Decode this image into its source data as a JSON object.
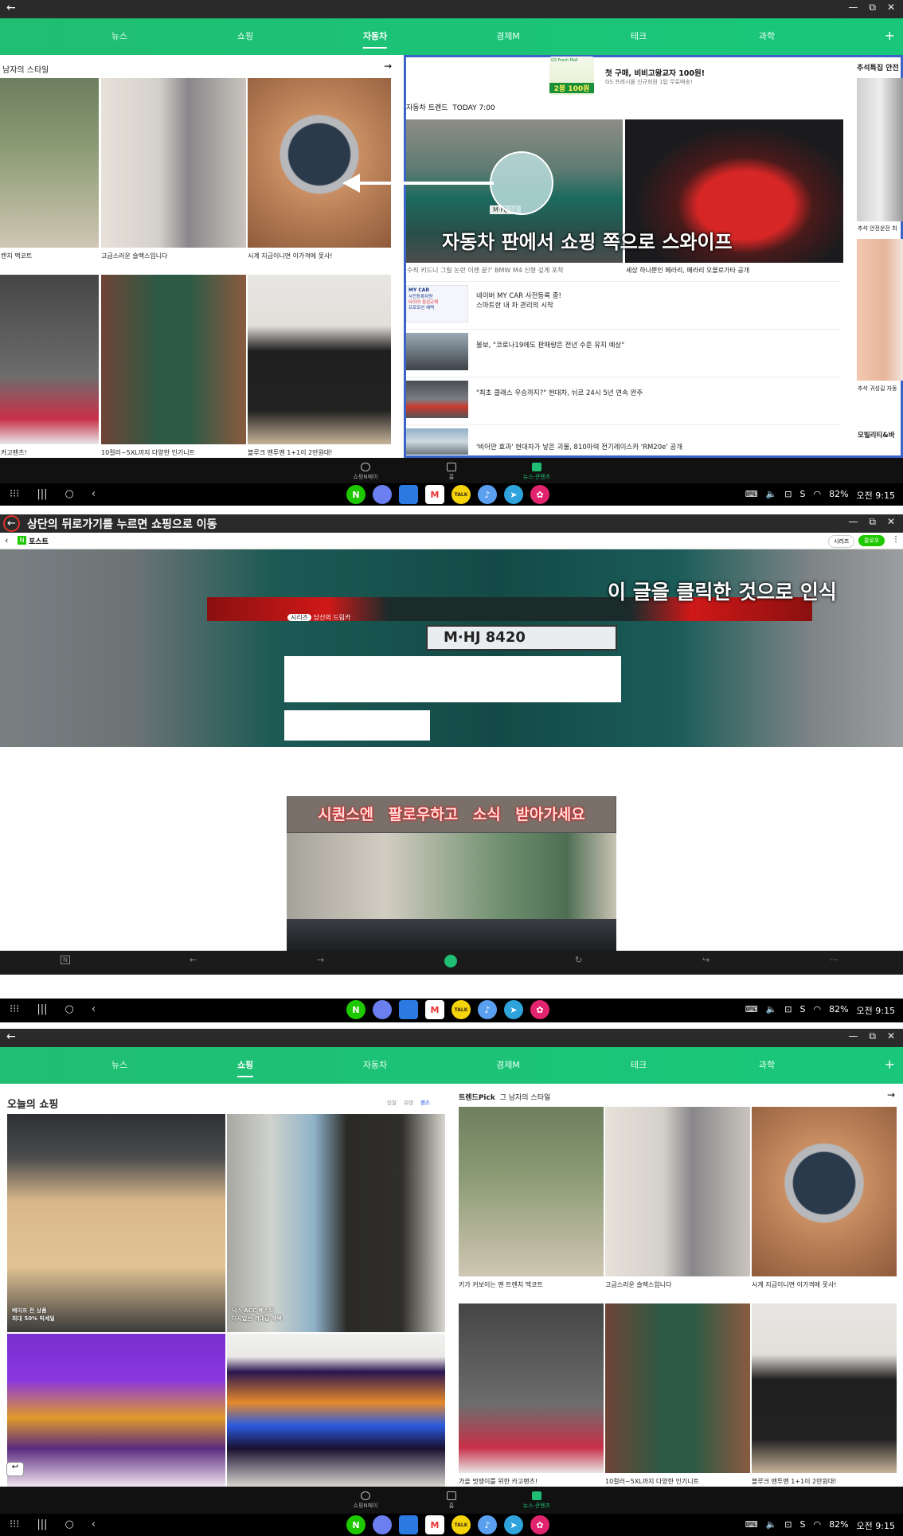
{
  "panel1": {
    "tabs": [
      "뉴스",
      "쇼핑",
      "자동차",
      "경제M",
      "테크",
      "과학"
    ],
    "active_tab": "자동차",
    "shopping_title": "남자의 스타일",
    "shopping_caps": [
      "캔치 맥코트",
      "고급스러운 슬랙스입니다",
      "시계 지금이니면 이가격에 못사!",
      "카고팬츠!",
      "10컬러~5XL까지 다양한 인기니트",
      "블루크 맨투맨 1+1이 2만원대!"
    ],
    "ad_badge": "GS Fresh Mall",
    "ad_price": "2봉 100원",
    "ad_line1": "첫 구매, 비비고왕교자 100원!",
    "ad_line2": "GS 프레시몰 신규회원 1탑 무료배송!",
    "car_trend_title": "자동차 트렌드",
    "car_trend_time": "TODAY 7:00",
    "car_caps": [
      "수직 키드니 그릴 논란 이젠 끝?' BMW M4 신형 깊게 포착",
      "세상 하나뿐인 페라리, 페라리 오몰로가타 공개"
    ],
    "mycar_badge": "MY CAR",
    "mycar_text1": "사전등록차량",
    "mycar_text2": "타이어 점검교체",
    "mycar_text3": "프로모션 혜택",
    "news_rows": [
      {
        "t1": "네이버 MY CAR 사전등록 중!",
        "t2": "스마트한 내 차 관리의 시작"
      },
      {
        "t1": "볼보, \"코로나19에도 판매량은 전년 수준 유지 예상\"",
        "t2": ""
      },
      {
        "t1": "\"최초 클래스 우승까지?\" 현대차, 뉘르 24시 5년 연속 완주",
        "t2": ""
      },
      {
        "t1": "'비어만 효과' 현대차가 낳은 괴물, 810마력 전기레이스카 'RM20e' 공개",
        "t2": ""
      }
    ],
    "right_col_title": "추석특집 안전",
    "right_cap1": "추석 안전운전 최",
    "right_cap2": "추석 귀성길 자동",
    "right_bottom": "모빌리티&바",
    "annotation": "자동차 판에서 쇼핑 쪽으로 스와이프",
    "car_plate": "M·HJ 24"
  },
  "bottom_nav": [
    "쇼핑N페이",
    "홈",
    "뉴스·콘텐츠"
  ],
  "status": {
    "battery": "82%",
    "time": "오전 9:15",
    "lang": "S"
  },
  "apps": [
    "N",
    "",
    "",
    "",
    "TALK",
    "",
    "",
    ""
  ],
  "panel2": {
    "annotation_top": "상단의 뒤로가기를 누르면 쇼핑으로 이동",
    "post_label": "포스트",
    "series_btn": "시리즈",
    "follow_btn": "팔로우",
    "series_tag": "시리즈",
    "series_name": "당신의 드림카",
    "annotation_mid": "이 글을 클릭한 것으로 인식",
    "banner_text": "시퀀스엔 팔로우하고 소식 받아가세요",
    "plate": "M·HJ 8420"
  },
  "panel3": {
    "tabs": [
      "뉴스",
      "쇼핑",
      "자동차",
      "경제M",
      "테크",
      "과학"
    ],
    "active_tab": "쇼핑",
    "today_title": "오늘의 쇼핑",
    "filters": [
      "있잖",
      "유텐",
      "펜즈"
    ],
    "left_caps": [
      {
        "a": "베이프 전 상품",
        "b": "최대 50% 빅세일"
      },
      {
        "a": "닥스 ACC 베스트",
        "b": "다시없는 역대급 혜택"
      }
    ],
    "trend_pick": "트렌드Pick",
    "trend_sub": "그 남자의 스타일",
    "trend_caps": [
      "키가 커보이는 맨 트렌치 맥코트",
      "고급스러운 슬랙스입니다",
      "시계 지금이니면 이가격에 못사!",
      "가을 멋쟁이를 위한 카고팬츠!",
      "10컬러~5XL까지 다양한 인기니트",
      "블루크 맨투맨 1+1이 2만원대!"
    ]
  },
  "colors": {
    "brand_green": "#1fbe72",
    "annotation_blue": "#3a64c8",
    "annotation_red": "#e0312a"
  }
}
